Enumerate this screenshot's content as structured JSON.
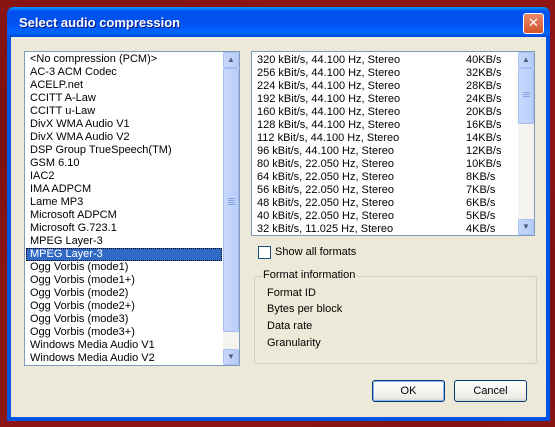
{
  "window": {
    "title": "Select audio compression",
    "close_label": "✕"
  },
  "codecs": {
    "items": [
      "<No compression (PCM)>",
      "AC-3 ACM Codec",
      "ACELP.net",
      "CCITT A-Law",
      "CCITT u-Law",
      "DivX WMA Audio V1",
      "DivX WMA Audio V2",
      "DSP Group TrueSpeech(TM)",
      "GSM 6.10",
      "IAC2",
      "IMA ADPCM",
      "Lame MP3",
      "Microsoft ADPCM",
      "Microsoft G.723.1",
      "MPEG Layer-3",
      "MPEG Layer-3",
      "Ogg Vorbis (mode1)",
      "Ogg Vorbis (mode1+)",
      "Ogg Vorbis (mode2)",
      "Ogg Vorbis (mode2+)",
      "Ogg Vorbis (mode3)",
      "Ogg Vorbis (mode3+)",
      "Windows Media Audio V1",
      "Windows Media Audio V2"
    ],
    "selected_index": 15
  },
  "formats": {
    "rows": [
      {
        "format": "320 kBit/s, 44.100 Hz, Stereo",
        "rate": "40KB/s"
      },
      {
        "format": "256 kBit/s, 44.100 Hz, Stereo",
        "rate": "32KB/s"
      },
      {
        "format": "224 kBit/s, 44.100 Hz, Stereo",
        "rate": "28KB/s"
      },
      {
        "format": "192 kBit/s, 44.100 Hz, Stereo",
        "rate": "24KB/s"
      },
      {
        "format": "160 kBit/s, 44.100 Hz, Stereo",
        "rate": "20KB/s"
      },
      {
        "format": "128 kBit/s, 44.100 Hz, Stereo",
        "rate": "16KB/s"
      },
      {
        "format": "112 kBit/s, 44.100 Hz, Stereo",
        "rate": "14KB/s"
      },
      {
        "format": "96 kBit/s, 44.100 Hz, Stereo",
        "rate": "12KB/s"
      },
      {
        "format": "80 kBit/s, 22.050 Hz, Stereo",
        "rate": "10KB/s"
      },
      {
        "format": "64 kBit/s, 22.050 Hz, Stereo",
        "rate": "8KB/s"
      },
      {
        "format": "56 kBit/s, 22.050 Hz, Stereo",
        "rate": "7KB/s"
      },
      {
        "format": "48 kBit/s, 22.050 Hz, Stereo",
        "rate": "6KB/s"
      },
      {
        "format": "40 kBit/s, 22.050 Hz, Stereo",
        "rate": "5KB/s"
      },
      {
        "format": "32 kBit/s, 11.025 Hz, Stereo",
        "rate": "4KB/s"
      }
    ]
  },
  "show_all": {
    "label": "Show all formats",
    "checked": false
  },
  "format_info": {
    "legend": "Format information",
    "fields": [
      "Format ID",
      "Bytes per block",
      "Data rate",
      "Granularity"
    ]
  },
  "buttons": {
    "ok": "OK",
    "cancel": "Cancel"
  },
  "colors": {
    "title_bar": "#0054e3",
    "selection": "#316ac5",
    "dialog_face": "#ece9d8"
  }
}
